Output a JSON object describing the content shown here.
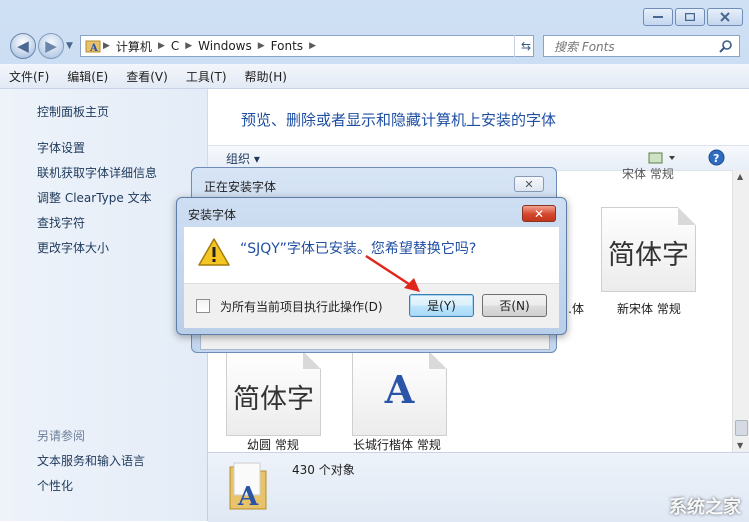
{
  "window": {
    "caption_buttons": [
      "minimize",
      "maximize",
      "close"
    ]
  },
  "address": {
    "crumbs": [
      "计算机",
      "C",
      "Windows",
      "Fonts"
    ]
  },
  "search": {
    "placeholder": "搜索 Fonts"
  },
  "menu": [
    "文件(F)",
    "编辑(E)",
    "查看(V)",
    "工具(T)",
    "帮助(H)"
  ],
  "leftpane": {
    "links": [
      "控制面板主页",
      "字体设置",
      "联机获取字体详细信息",
      "调整 ClearType 文本",
      "查找字符",
      "更改字体大小"
    ],
    "see_also": "另请参阅",
    "see_also_links": [
      "文本服务和输入语言",
      "个性化"
    ]
  },
  "content": {
    "heading": "预览、删除或者显示和隐藏计算机上安装的字体",
    "organize": "组织 ▾",
    "tiles": [
      {
        "glyph": "简体字",
        "label": "新宋体 常规",
        "top_label": "宋体 常规"
      },
      {
        "glyph": "简体字",
        "label": "幼圆 常规"
      },
      {
        "glyph": "A",
        "label": "长城行楷体 常规"
      }
    ],
    "partial_label": "…体"
  },
  "status": {
    "count": "430 个对象"
  },
  "dialog_back": {
    "title": "正在安装字体",
    "close": "✕"
  },
  "dialog": {
    "title": "安装字体",
    "close": "✕",
    "message": "“SJQY”字体已安装。您希望替换它吗?",
    "checkbox_label": "为所有当前项目执行此操作(D)",
    "yes": "是(Y)",
    "no": "否(N)"
  },
  "watermark": "系统之家",
  "colors": {
    "heading": "#1f4fa3",
    "arrow": "#e0261b",
    "close": "#d4472c"
  }
}
